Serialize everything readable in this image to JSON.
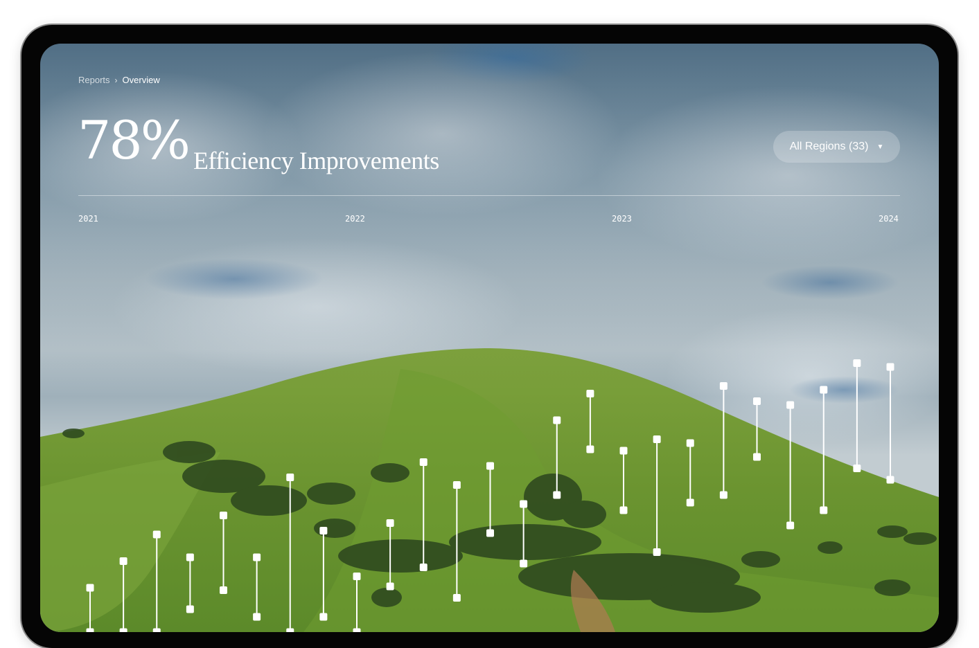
{
  "breadcrumb": {
    "items": [
      "Reports",
      "Overview"
    ],
    "separator": "›"
  },
  "header": {
    "stat_value": "78%",
    "stat_label": "Efficiency Improvements"
  },
  "filter": {
    "label": "All Regions (33)",
    "icon": "chevron-down-icon"
  },
  "colors": {
    "marker": "#ffffff",
    "grass": "#6e9a33",
    "sky": "#a9b9c2"
  },
  "chart_data": {
    "type": "range",
    "x_ticks": [
      "2021",
      "2022",
      "2023",
      "2024"
    ],
    "y_scale_note": "no y-axis shown; values are relative levels (0 = bottom of visible area, 100 = top)",
    "ranges": [
      {
        "low": 0,
        "high": 8
      },
      {
        "low": 0,
        "high": 15
      },
      {
        "low": 0,
        "high": 22
      },
      {
        "low": 6,
        "high": 16
      },
      {
        "low": 11,
        "high": 27
      },
      {
        "low": 4,
        "high": 16
      },
      {
        "low": 0,
        "high": 37
      },
      {
        "low": 4,
        "high": 23
      },
      {
        "low": 0,
        "high": 11
      },
      {
        "low": 12,
        "high": 25
      },
      {
        "low": 17,
        "high": 41
      },
      {
        "low": 9,
        "high": 35
      },
      {
        "low": 26,
        "high": 40
      },
      {
        "low": 18,
        "high": 30
      },
      {
        "low": 36,
        "high": 52
      },
      {
        "low": 48,
        "high": 59
      },
      {
        "low": 32,
        "high": 44
      },
      {
        "low": 21,
        "high": 47
      },
      {
        "low": 34,
        "high": 46
      },
      {
        "low": 36,
        "high": 61
      },
      {
        "low": 46,
        "high": 57
      },
      {
        "low": 28,
        "high": 56
      },
      {
        "low": 32,
        "high": 60
      },
      {
        "low": 43,
        "high": 67
      },
      {
        "low": 40,
        "high": 66
      }
    ]
  }
}
